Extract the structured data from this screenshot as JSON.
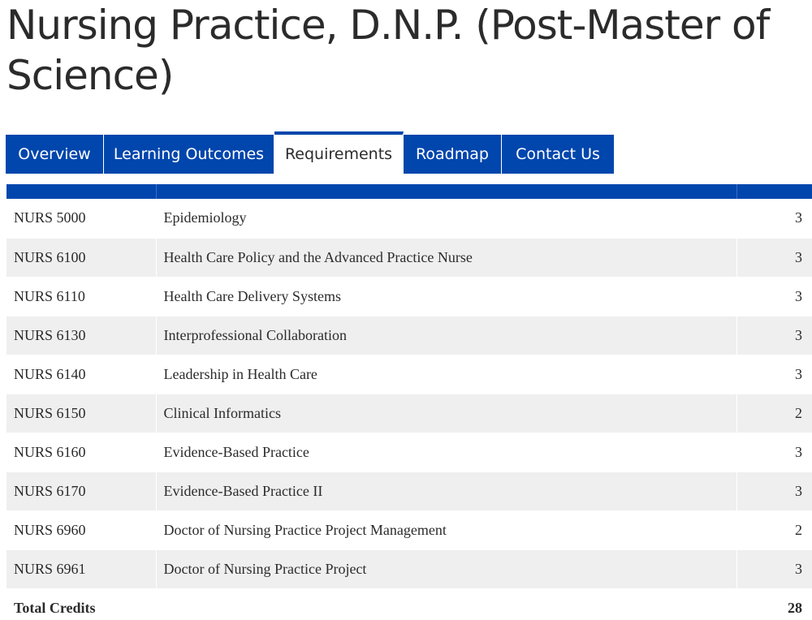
{
  "page": {
    "title": "Nursing Practice, D.N.P. (Post-Master of Science)"
  },
  "tabs": [
    {
      "label": "Overview",
      "active": false
    },
    {
      "label": "Learning Outcomes",
      "active": false
    },
    {
      "label": "Requirements",
      "active": true
    },
    {
      "label": "Roadmap",
      "active": false
    },
    {
      "label": "Contact Us",
      "active": false
    }
  ],
  "courses": [
    {
      "code": "NURS 5000",
      "title": "Epidemiology",
      "credits": "3"
    },
    {
      "code": "NURS 6100",
      "title": "Health Care Policy and the Advanced Practice Nurse",
      "credits": "3"
    },
    {
      "code": "NURS 6110",
      "title": "Health Care Delivery Systems",
      "credits": "3"
    },
    {
      "code": "NURS 6130",
      "title": "Interprofessional Collaboration",
      "credits": "3"
    },
    {
      "code": "NURS 6140",
      "title": "Leadership in Health Care",
      "credits": "3"
    },
    {
      "code": "NURS 6150",
      "title": "Clinical Informatics",
      "credits": "2"
    },
    {
      "code": "NURS 6160",
      "title": "Evidence-Based Practice",
      "credits": "3"
    },
    {
      "code": "NURS 6170",
      "title": "Evidence-Based Practice II",
      "credits": "3"
    },
    {
      "code": "NURS 6960",
      "title": "Doctor of Nursing Practice Project Management",
      "credits": "2"
    },
    {
      "code": "NURS 6961",
      "title": "Doctor of Nursing Practice Project",
      "credits": "3"
    }
  ],
  "total": {
    "label": "Total Credits",
    "value": "28"
  },
  "colors": {
    "brand_blue": "#0046ad",
    "row_alt": "#efefef",
    "text": "#2b2b2b"
  }
}
